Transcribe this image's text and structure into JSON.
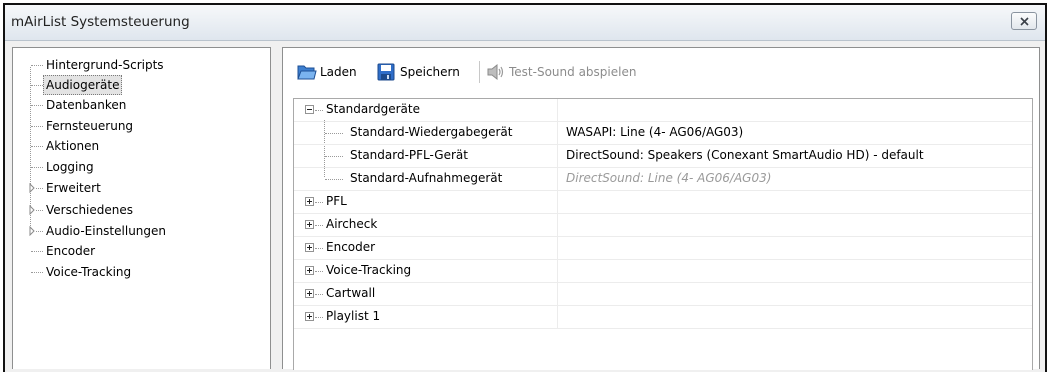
{
  "window": {
    "title": "mAirList Systemsteuerung",
    "close_icon": "close-icon"
  },
  "sidebar": {
    "items": [
      {
        "label": "Hintergrund-Scripts",
        "expandable": false,
        "selected": false
      },
      {
        "label": "Audiogeräte",
        "expandable": false,
        "selected": true
      },
      {
        "label": "Datenbanken",
        "expandable": false,
        "selected": false
      },
      {
        "label": "Fernsteuerung",
        "expandable": false,
        "selected": false
      },
      {
        "label": "Aktionen",
        "expandable": false,
        "selected": false
      },
      {
        "label": "Logging",
        "expandable": false,
        "selected": false
      },
      {
        "label": "Erweitert",
        "expandable": true,
        "selected": false
      },
      {
        "label": "Verschiedenes",
        "expandable": true,
        "selected": false
      },
      {
        "label": "Audio-Einstellungen",
        "expandable": true,
        "selected": false
      },
      {
        "label": "Encoder",
        "expandable": false,
        "selected": false
      },
      {
        "label": "Voice-Tracking",
        "expandable": false,
        "selected": false
      }
    ]
  },
  "toolbar": {
    "load_label": "Laden",
    "save_label": "Speichern",
    "test_sound_label": "Test-Sound abspielen"
  },
  "grid": {
    "standard_group": {
      "label": "Standardgeräte",
      "rows": [
        {
          "name": "Standard-Wiedergabegerät",
          "value": "WASAPI: Line (4- AG06/AG03)",
          "placeholder": false
        },
        {
          "name": "Standard-PFL-Gerät",
          "value": "DirectSound: Speakers (Conexant SmartAudio HD) - default",
          "placeholder": false
        },
        {
          "name": "Standard-Aufnahmegerät",
          "value": "DirectSound: Line (4- AG06/AG03)",
          "placeholder": true
        }
      ]
    },
    "groups": [
      {
        "label": "PFL"
      },
      {
        "label": "Aircheck"
      },
      {
        "label": "Encoder"
      },
      {
        "label": "Voice-Tracking"
      },
      {
        "label": "Cartwall"
      },
      {
        "label": "Playlist 1"
      }
    ]
  },
  "colors": {
    "selection": "#e3e3e3",
    "disabled_text": "#8c8c8c",
    "placeholder_text": "#9a9a9a"
  }
}
